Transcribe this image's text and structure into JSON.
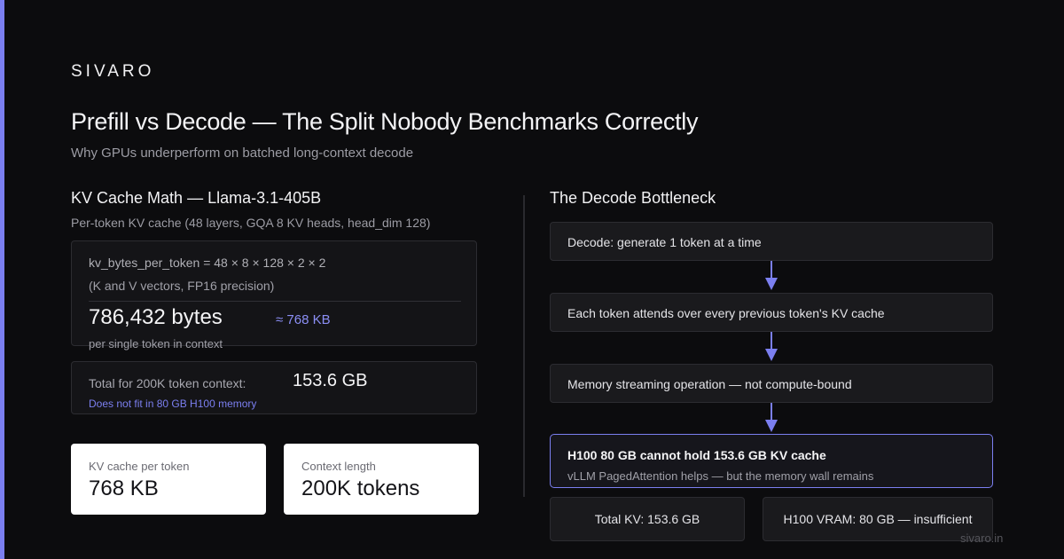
{
  "brand": "SIVARO",
  "title": "Prefill vs Decode — The Split Nobody Benchmarks Correctly",
  "subtitle": "Why GPUs underperform on batched long-context decode",
  "left": {
    "heading": "KV Cache Math — Llama-3.1-405B",
    "subheading": "Per-token KV cache (48 layers, GQA 8 KV heads, head_dim 128)",
    "formula": "kv_bytes_per_token = 48 × 8 × 128 × 2 × 2",
    "formula_note": "(K and V vectors, FP16 precision)",
    "bytes_value": "786,432 bytes",
    "bytes_approx": "≈ 768 KB",
    "bytes_caption": "per single token in context",
    "total_label": "Total for 200K token context:",
    "total_value": "153.6 GB",
    "total_warning": "Does not fit in 80 GB H100 memory",
    "stats": [
      {
        "label": "KV cache per token",
        "value": "768 KB"
      },
      {
        "label": "Context length",
        "value": "200K tokens"
      }
    ]
  },
  "right": {
    "heading": "The Decode Bottleneck",
    "steps": [
      "Decode: generate 1 token at a time",
      "Each token attends over every previous token's KV cache",
      "Memory streaming operation — not compute-bound"
    ],
    "highlight_title": "H100 80 GB cannot hold 153.6 GB KV cache",
    "highlight_sub": "vLLM PagedAttention helps — but the memory wall remains",
    "bottom": [
      "Total KV: 153.6 GB",
      "H100 VRAM: 80 GB — insufficient"
    ]
  },
  "footer": "sivaro.in",
  "colors": {
    "background": "#0c0c0e",
    "accent": "#7b7ff0",
    "card_white": "#ffffff"
  },
  "icons": {
    "arrow": "arrow-down-icon"
  }
}
